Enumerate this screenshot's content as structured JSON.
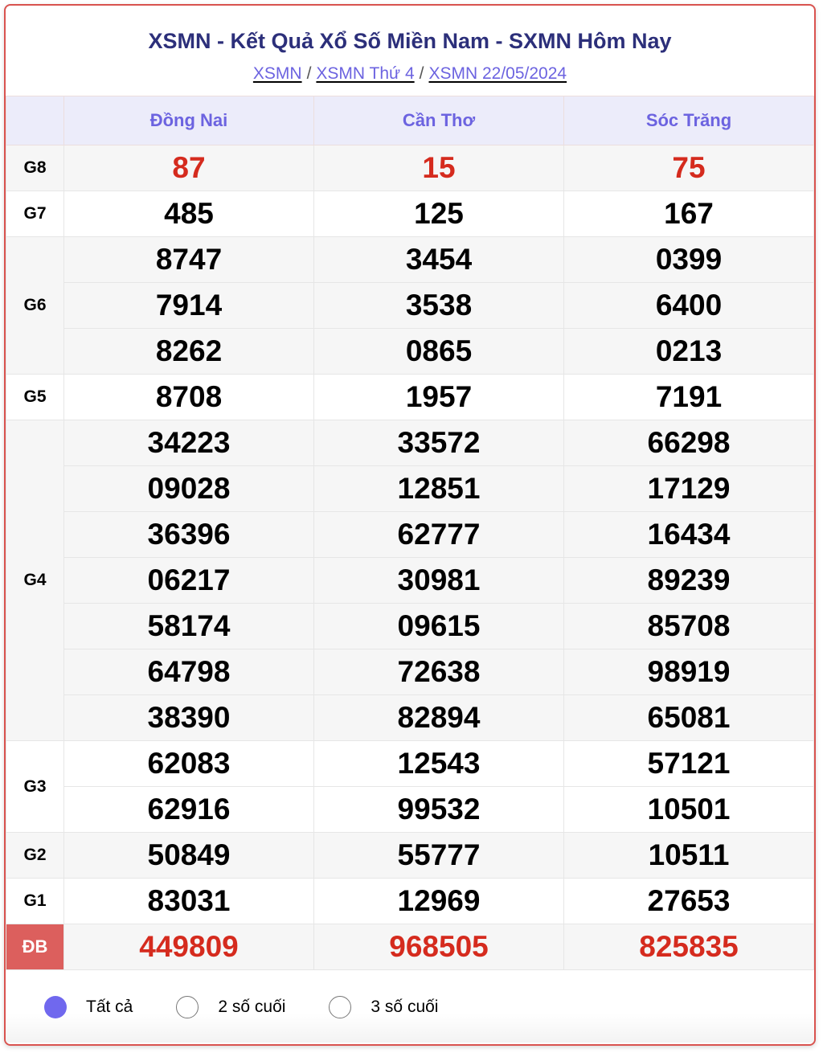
{
  "header": {
    "title": "XSMN - Kết Quả Xổ Số Miền Nam - SXMN Hôm Nay",
    "breadcrumb": [
      "XSMN",
      "XSMN Thứ 4",
      "XSMN 22/05/2024"
    ],
    "separator": "/"
  },
  "table": {
    "provinces": [
      "Đồng Nai",
      "Cần Thơ",
      "Sóc Trăng"
    ],
    "prizes": [
      {
        "label": "G8",
        "rows": [
          [
            "87",
            "15",
            "75"
          ]
        ],
        "highlight": true
      },
      {
        "label": "G7",
        "rows": [
          [
            "485",
            "125",
            "167"
          ]
        ]
      },
      {
        "label": "G6",
        "rows": [
          [
            "8747",
            "3454",
            "0399"
          ],
          [
            "7914",
            "3538",
            "6400"
          ],
          [
            "8262",
            "0865",
            "0213"
          ]
        ]
      },
      {
        "label": "G5",
        "rows": [
          [
            "8708",
            "1957",
            "7191"
          ]
        ]
      },
      {
        "label": "G4",
        "rows": [
          [
            "34223",
            "33572",
            "66298"
          ],
          [
            "09028",
            "12851",
            "17129"
          ],
          [
            "36396",
            "62777",
            "16434"
          ],
          [
            "06217",
            "30981",
            "89239"
          ],
          [
            "58174",
            "09615",
            "85708"
          ],
          [
            "64798",
            "72638",
            "98919"
          ],
          [
            "38390",
            "82894",
            "65081"
          ]
        ]
      },
      {
        "label": "G3",
        "rows": [
          [
            "62083",
            "12543",
            "57121"
          ],
          [
            "62916",
            "99532",
            "10501"
          ]
        ]
      },
      {
        "label": "G2",
        "rows": [
          [
            "50849",
            "55777",
            "10511"
          ]
        ]
      },
      {
        "label": "G1",
        "rows": [
          [
            "83031",
            "12969",
            "27653"
          ]
        ]
      },
      {
        "label": "ĐB",
        "rows": [
          [
            "449809",
            "968505",
            "825835"
          ]
        ],
        "highlight": true,
        "special": true
      }
    ]
  },
  "filter": {
    "options": [
      {
        "label": "Tất cả",
        "checked": true
      },
      {
        "label": "2 số cuối",
        "checked": false
      },
      {
        "label": "3 số cuối",
        "checked": false
      }
    ]
  },
  "colors": {
    "accent": "#6c63e0",
    "title": "#2c2f7a",
    "highlight_number": "#d52b1e",
    "special_label_bg": "#dc5f5d",
    "border": "#d9534f"
  }
}
